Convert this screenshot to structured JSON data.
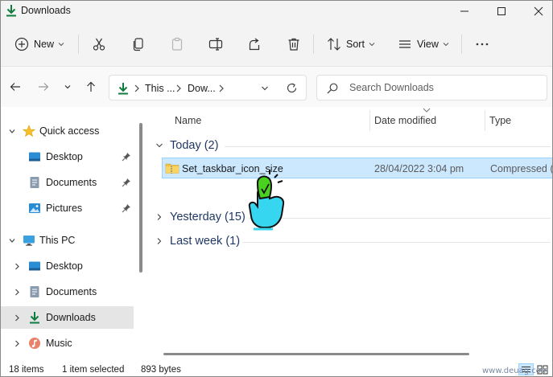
{
  "window": {
    "title": "Downloads",
    "controls": [
      "minimize",
      "maximize",
      "close"
    ]
  },
  "command_bar": {
    "new_label": "New",
    "sort_label": "Sort",
    "view_label": "View",
    "icons": [
      "cut-icon",
      "copy-icon",
      "paste-icon",
      "rename-icon",
      "share-icon",
      "delete-icon",
      "more-icon"
    ]
  },
  "address": {
    "crumbs": [
      "This ...",
      "Dow..."
    ],
    "search_placeholder": "Search Downloads"
  },
  "nav": {
    "items": [
      {
        "label": "Quick access",
        "icon": "star-icon"
      },
      {
        "label": "Desktop",
        "icon": "desktop-icon",
        "pinned": true
      },
      {
        "label": "Documents",
        "icon": "documents-icon",
        "pinned": true
      },
      {
        "label": "Pictures",
        "icon": "pictures-icon",
        "pinned": true
      },
      {
        "label": "This PC",
        "icon": "monitor-icon"
      },
      {
        "label": "Desktop",
        "icon": "desktop-icon"
      },
      {
        "label": "Documents",
        "icon": "documents-icon"
      },
      {
        "label": "Downloads",
        "icon": "download-icon",
        "selected": true
      },
      {
        "label": "Music",
        "icon": "music-icon"
      }
    ]
  },
  "columns": {
    "name": "Name",
    "date": "Date modified",
    "type": "Type"
  },
  "groups": [
    {
      "label": "Today (2)",
      "expanded": true
    },
    {
      "label": "Yesterday (15)",
      "expanded": false
    },
    {
      "label": "Last week (1)",
      "expanded": false
    }
  ],
  "files": [
    {
      "name": "Set_taskbar_icon_size",
      "date": "28/04/2022 3:04 pm",
      "type": "Compressed (zi",
      "selected": true
    }
  ],
  "status": {
    "items": "18 items",
    "selection": "1 item selected",
    "size": "893 bytes"
  },
  "watermark": "www.deuag.com",
  "colors": {
    "accent": "#0f7b3f",
    "selection_bg": "#cce8ff",
    "selection_border": "#99d1ff",
    "group_text": "#1f3864",
    "hand_fill": "#36d6f0",
    "hand_accent": "#4ad01e"
  }
}
